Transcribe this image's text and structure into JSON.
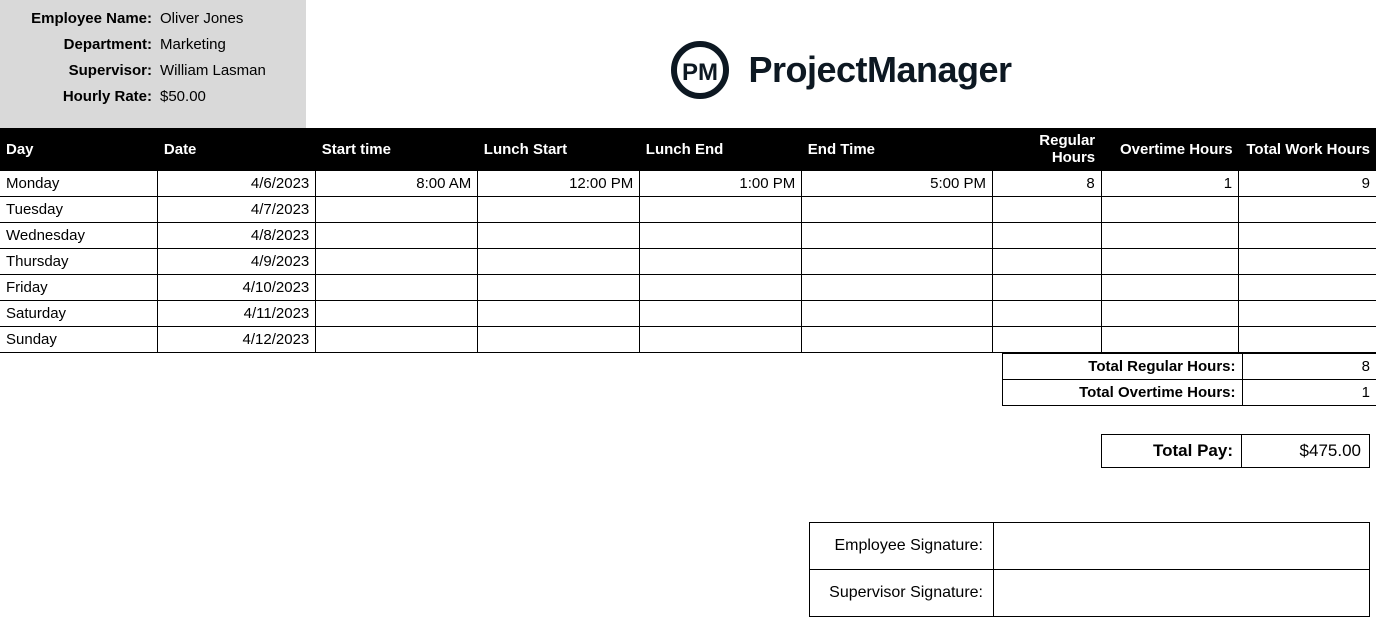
{
  "employee": {
    "name_label": "Employee Name:",
    "name_value": "Oliver Jones",
    "dept_label": "Department:",
    "dept_value": "Marketing",
    "supervisor_label": "Supervisor:",
    "supervisor_value": "William Lasman",
    "rate_label": "Hourly Rate:",
    "rate_value": "$50.00"
  },
  "brand": {
    "logo_initials": "PM",
    "name": "ProjectManager"
  },
  "columns": {
    "day": "Day",
    "date": "Date",
    "start": "Start time",
    "lunch_start": "Lunch Start",
    "lunch_end": "Lunch End",
    "end": "End Time",
    "regular": "Regular Hours",
    "overtime": "Overtime Hours",
    "total": "Total Work Hours"
  },
  "rows": [
    {
      "day": "Monday",
      "date": "4/6/2023",
      "start": "8:00 AM",
      "lunch_start": "12:00 PM",
      "lunch_end": "1:00 PM",
      "end": "5:00 PM",
      "regular": "8",
      "overtime": "1",
      "total": "9"
    },
    {
      "day": "Tuesday",
      "date": "4/7/2023",
      "start": "",
      "lunch_start": "",
      "lunch_end": "",
      "end": "",
      "regular": "",
      "overtime": "",
      "total": ""
    },
    {
      "day": "Wednesday",
      "date": "4/8/2023",
      "start": "",
      "lunch_start": "",
      "lunch_end": "",
      "end": "",
      "regular": "",
      "overtime": "",
      "total": ""
    },
    {
      "day": "Thursday",
      "date": "4/9/2023",
      "start": "",
      "lunch_start": "",
      "lunch_end": "",
      "end": "",
      "regular": "",
      "overtime": "",
      "total": ""
    },
    {
      "day": "Friday",
      "date": "4/10/2023",
      "start": "",
      "lunch_start": "",
      "lunch_end": "",
      "end": "",
      "regular": "",
      "overtime": "",
      "total": ""
    },
    {
      "day": "Saturday",
      "date": "4/11/2023",
      "start": "",
      "lunch_start": "",
      "lunch_end": "",
      "end": "",
      "regular": "",
      "overtime": "",
      "total": ""
    },
    {
      "day": "Sunday",
      "date": "4/12/2023",
      "start": "",
      "lunch_start": "",
      "lunch_end": "",
      "end": "",
      "regular": "",
      "overtime": "",
      "total": ""
    }
  ],
  "totals": {
    "regular_label": "Total Regular Hours:",
    "regular_value": "8",
    "overtime_label": "Total Overtime Hours:",
    "overtime_value": "1",
    "pay_label": "Total Pay:",
    "pay_value": "$475.00"
  },
  "signatures": {
    "employee_label": "Employee Signature:",
    "supervisor_label": "Supervisor Signature:"
  }
}
